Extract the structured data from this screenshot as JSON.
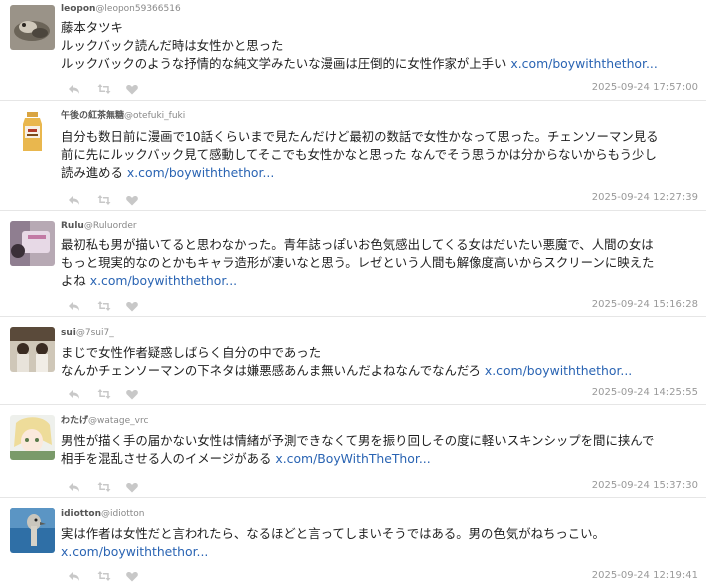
{
  "tweets": [
    {
      "name": "leopon",
      "handle": "@leopon59366516",
      "lines": [
        "藤本タツキ",
        "ルックバック読んだ時は女性かと思った",
        "ルックバックのような抒情的な純文学みたいな漫画は圧倒的に女性作家が上手い"
      ],
      "link": "x.com/boywiththethor...",
      "timestamp": "2025-09-24 17:57:00"
    },
    {
      "name": "午後の紅茶無糖",
      "handle": "@otefuki_fuki",
      "lines": [
        "自分も数日前に漫画で10話くらいまで見たんだけど最初の数話で女性かなって思った。チェンソーマン見る",
        "前に先にルックバック見て感動してそこでも女性かなと思った なんでそう思うかは分からないからもう少し",
        "読み進める"
      ],
      "link": "x.com/boywiththethor...",
      "timestamp": "2025-09-24 12:27:39"
    },
    {
      "name": "Rulu",
      "handle": "@Ruluorder",
      "lines": [
        "最初私も男が描いてると思わなかった。青年誌っぽいお色気感出してくる女はだいたい悪魔で、人間の女は",
        "もっと現実的なのとかもキャラ造形が凄いなと思う。レゼという人間も解像度高いからスクリーンに映えた",
        "よね"
      ],
      "link": "x.com/boywiththethor...",
      "timestamp": "2025-09-24 15:16:28"
    },
    {
      "name": "sui",
      "handle": "@7sui7_",
      "lines": [
        "まじで女性作者疑惑しばらく自分の中であった",
        "なんかチェンソーマンの下ネタは嫌悪感あんま無いんだよねなんでなんだろ"
      ],
      "link": "x.com/boywiththethor...",
      "timestamp": "2025-09-24 14:25:55"
    },
    {
      "name": "わたげ",
      "handle": "@watage_vrc",
      "lines": [
        "男性が描く手の届かない女性は情緒が予測できなくて男を振り回しその度に軽いスキンシップを間に挟んで",
        "相手を混乱させる人のイメージがある"
      ],
      "link": "x.com/BoyWithTheThor...",
      "timestamp": "2025-09-24 15:37:30"
    },
    {
      "name": "idiotton",
      "handle": "@idiotton",
      "lines": [
        "実は作者は女性だと言われたら、なるほどと言ってしまいそうではある。男の色気がねちっこい。"
      ],
      "link": "x.com/boywiththethor...",
      "timestamp": "2025-09-24 12:19:41"
    }
  ],
  "icons": [
    "reply-icon",
    "retweet-icon",
    "like-icon"
  ],
  "colors": {
    "link": "#2a64b3",
    "timestamp": "#999999",
    "divider": "#e6e6e6"
  }
}
